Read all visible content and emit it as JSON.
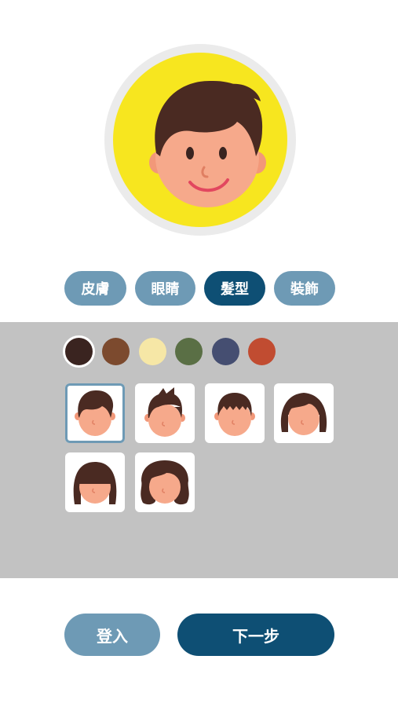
{
  "tabs": [
    {
      "label": "皮膚",
      "active": false
    },
    {
      "label": "眼睛",
      "active": false
    },
    {
      "label": "髮型",
      "active": true
    },
    {
      "label": "裝飾",
      "active": false
    }
  ],
  "hair_colors": [
    "#3a2420",
    "#7c4a2e",
    "#f6e7a6",
    "#5a6f45",
    "#454e71",
    "#c14c31"
  ],
  "selected_color_index": 0,
  "hair_styles": [
    "short-side-part",
    "spiky",
    "crew-cut",
    "bob",
    "long-bangs",
    "long-wavy"
  ],
  "selected_style_index": 0,
  "colors": {
    "accent": "#0e4f74",
    "secondary": "#6e9ab5",
    "avatar_background": "#f7e61f",
    "panel": "#c2c2c2",
    "skin": "#f6a98b"
  },
  "buttons": {
    "login": "登入",
    "next": "下一步"
  }
}
